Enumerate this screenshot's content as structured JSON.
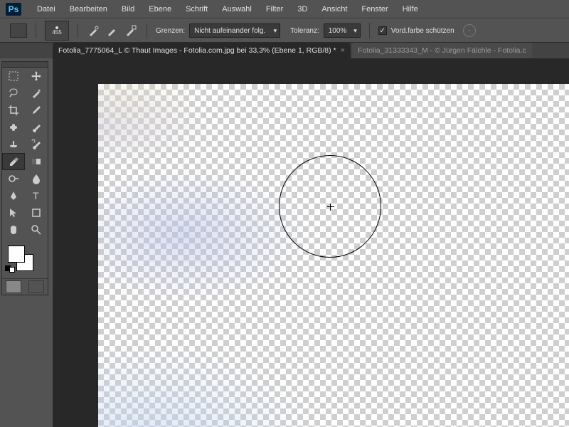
{
  "app": {
    "logo": "Ps"
  },
  "menu": [
    "Datei",
    "Bearbeiten",
    "Bild",
    "Ebene",
    "Schrift",
    "Auswahl",
    "Filter",
    "3D",
    "Ansicht",
    "Fenster",
    "Hilfe"
  ],
  "options": {
    "brush_size": "455",
    "grenzen_label": "Grenzen:",
    "grenzen_value": "Nicht aufeinander folg.",
    "toleranz_label": "Toleranz:",
    "toleranz_value": "100%",
    "protect_label": "Vord.farbe schützen",
    "protect_checked": "✓"
  },
  "tabs": [
    {
      "label": "Fotolia_7775064_L © Thaut Images - Fotolia.com.jpg bei 33,3% (Ebene 1, RGB/8) *",
      "active": true
    },
    {
      "label": "Fotolia_31333343_M - © Jürgen Fälchle - Fotolia.c",
      "active": false
    }
  ],
  "tools": [
    "marquee",
    "move",
    "lasso",
    "magic-wand",
    "crop",
    "eyedropper",
    "healing",
    "brush",
    "clone",
    "history-brush",
    "bg-eraser",
    "gradient",
    "dodge",
    "blur",
    "pen",
    "type",
    "path-select",
    "shape",
    "hand",
    "zoom"
  ],
  "selected_tool": "bg-eraser"
}
